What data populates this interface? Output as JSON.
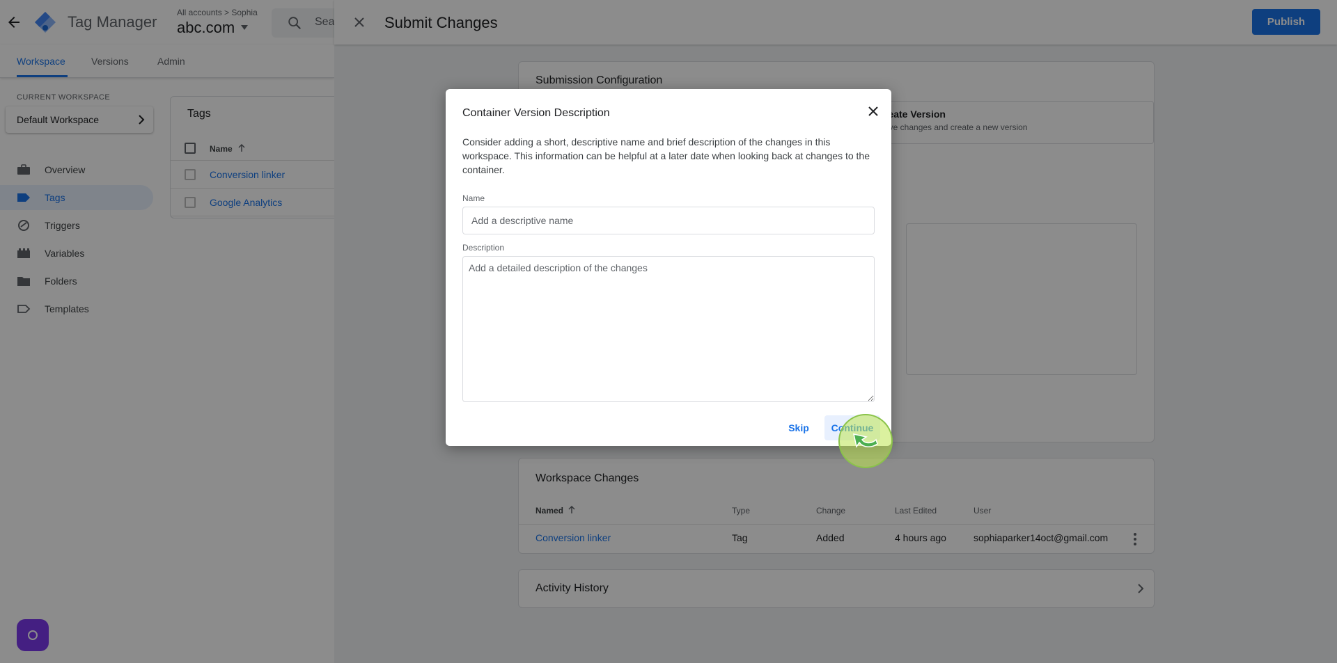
{
  "app": {
    "name": "Tag Manager",
    "breadcrumb": "All accounts > Sophia",
    "container": "abc.com",
    "search_placeholder": "Sea"
  },
  "nav": {
    "tabs": [
      {
        "label": "Workspace",
        "active": true
      },
      {
        "label": "Versions",
        "active": false
      },
      {
        "label": "Admin",
        "active": false
      }
    ]
  },
  "sidebar": {
    "current_workspace_label": "CURRENT WORKSPACE",
    "workspace_name": "Default Workspace",
    "items": [
      {
        "label": "Overview",
        "icon": "briefcase-icon",
        "active": false
      },
      {
        "label": "Tags",
        "icon": "tag-icon",
        "active": true
      },
      {
        "label": "Triggers",
        "icon": "trigger-icon",
        "active": false
      },
      {
        "label": "Variables",
        "icon": "variables-icon",
        "active": false
      },
      {
        "label": "Folders",
        "icon": "folder-icon",
        "active": false
      },
      {
        "label": "Templates",
        "icon": "template-icon",
        "active": false
      }
    ]
  },
  "tags_card": {
    "title": "Tags",
    "column_name": "Name",
    "rows": [
      "Conversion linker",
      "Google Analytics"
    ]
  },
  "panel": {
    "title": "Submit Changes",
    "publish_label": "Publish",
    "submission": {
      "title": "Submission Configuration",
      "create_version_title": "reate Version",
      "create_version_sub": "ave changes and create a new version"
    },
    "changes": {
      "title": "Workspace Changes",
      "headers": [
        "Named",
        "Type",
        "Change",
        "Last Edited",
        "User"
      ],
      "rows": [
        {
          "name": "Conversion linker",
          "type": "Tag",
          "change": "Added",
          "last_edited": "4 hours ago",
          "user": "sophiaparker14oct@gmail.com"
        }
      ]
    },
    "activity_title": "Activity History"
  },
  "dialog": {
    "title": "Container Version Description",
    "body": "Consider adding a short, descriptive name and brief description of the changes in this workspace. This information can be helpful at a later date when looking back at changes to the container.",
    "name_label": "Name",
    "name_placeholder": "Add a descriptive name",
    "name_value": "",
    "description_label": "Description",
    "description_placeholder": "Add a detailed description of the changes",
    "description_value": "",
    "skip_label": "Skip",
    "continue_label": "Continue"
  },
  "colors": {
    "accent": "#1a73e8",
    "fab": "#7c3aed",
    "click_indicator": "#8bc34a"
  }
}
